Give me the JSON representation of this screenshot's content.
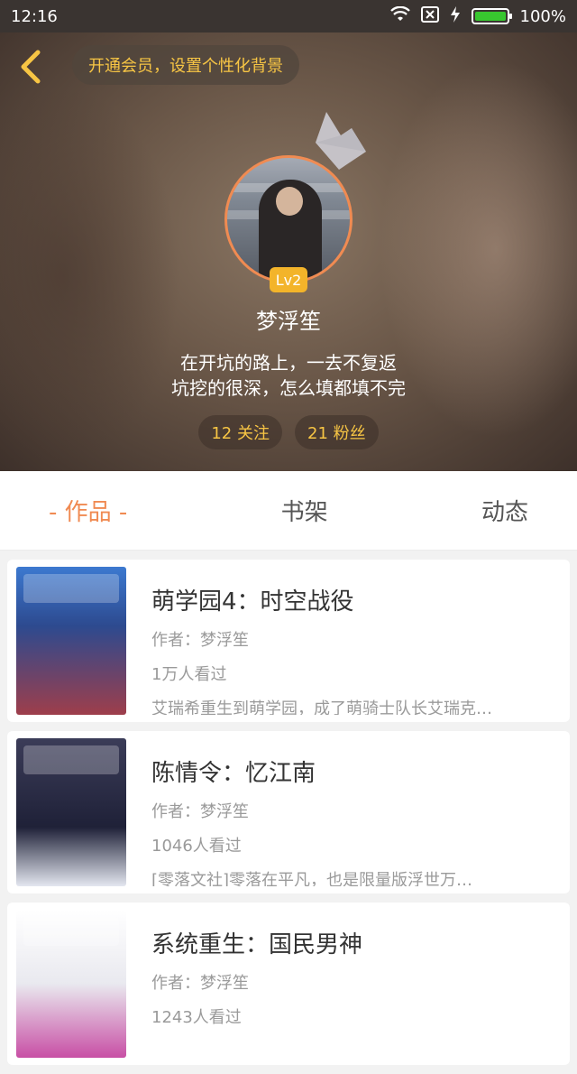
{
  "status_bar": {
    "time": "12:16",
    "battery_percent": "100%"
  },
  "header": {
    "vip_banner": "开通会员，设置个性化背景"
  },
  "profile": {
    "level": "Lv2",
    "username": "梦浮笙",
    "bio_line1": "在开坑的路上，一去不复返",
    "bio_line2": "坑挖的很深，怎么填都填不完",
    "stats": {
      "following": "12 关注",
      "fans": "21 粉丝"
    }
  },
  "tabs": [
    {
      "label": "- 作品 -",
      "active": true
    },
    {
      "label": "书架",
      "active": false
    },
    {
      "label": "动态",
      "active": false
    }
  ],
  "books": [
    {
      "title": "萌学园4：时空战役",
      "author": "作者：梦浮笙",
      "views": "1万人看过",
      "desc": "艾瑞希重生到萌学园，成了萌骑士队长艾瑞克…"
    },
    {
      "title": "陈情令：忆江南",
      "author": "作者：梦浮笙",
      "views": "1046人看过",
      "desc": "[零落文社]零落在平凡，也是限量版浮世万…"
    },
    {
      "title": "系统重生：国民男神",
      "author": "作者：梦浮笙",
      "views": "1243人看过",
      "desc": ""
    }
  ],
  "colors": {
    "accent": "#f08a52",
    "gold": "#f7c544",
    "level_badge": "#f3b42a"
  }
}
